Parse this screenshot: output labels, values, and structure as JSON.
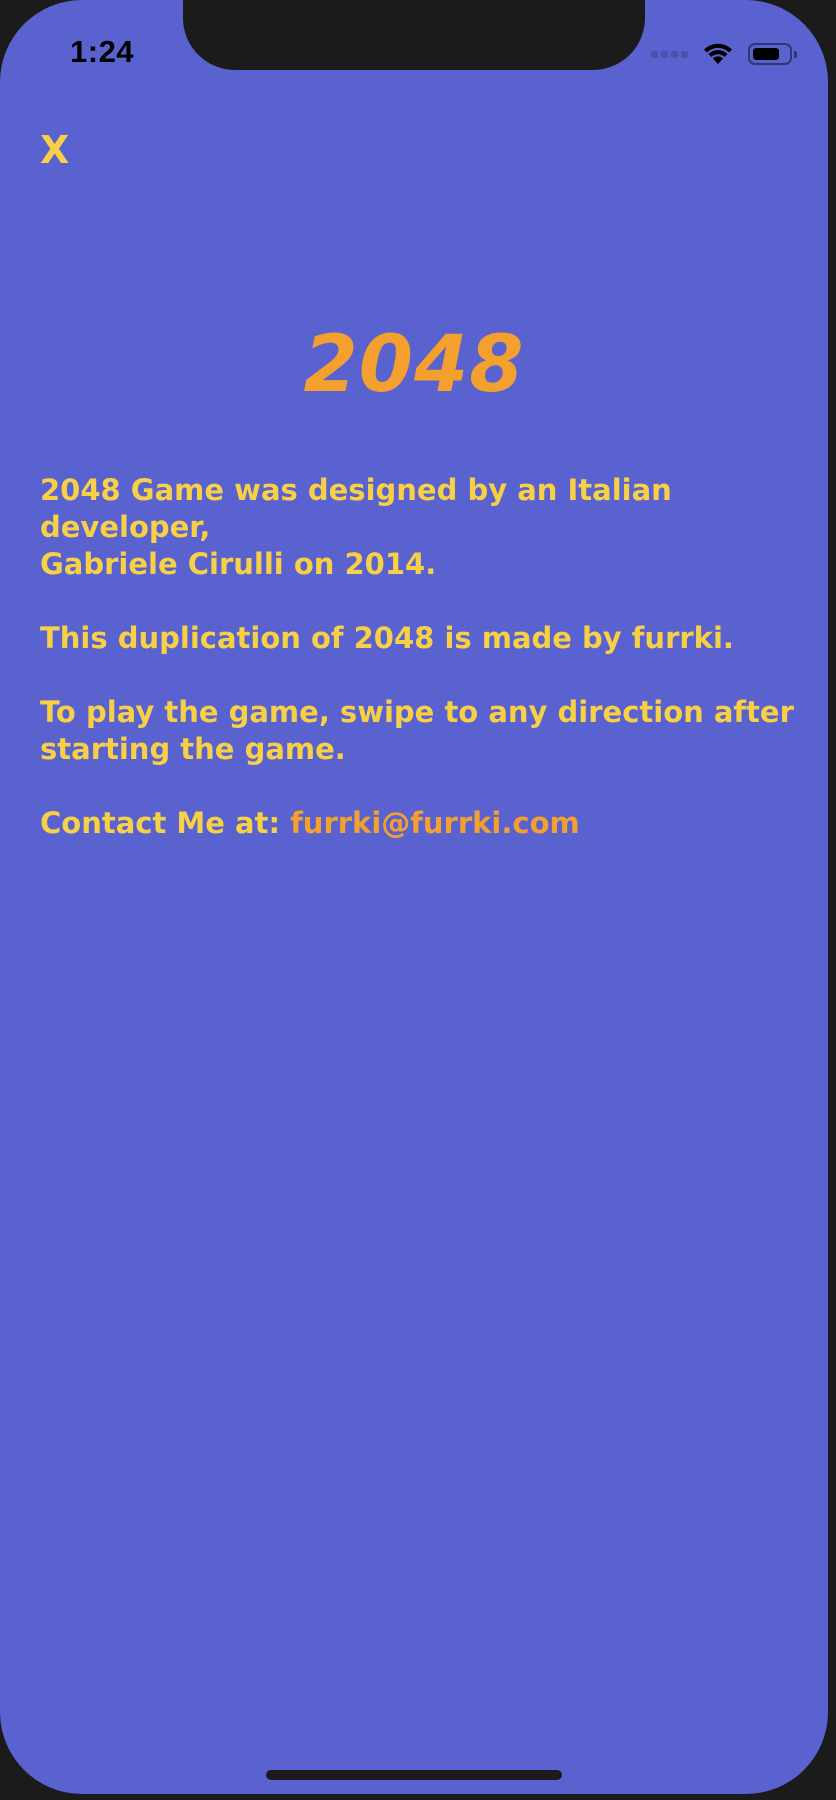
{
  "status_bar": {
    "time": "1:24",
    "icons": [
      "signal-icon",
      "wifi-icon",
      "battery-icon"
    ]
  },
  "header": {
    "close_label": "X"
  },
  "main": {
    "title": "2048",
    "paragraphs": [
      "2048 Game was designed by an Italian developer,\nGabriele Cirulli on 2014.",
      "This duplication of 2048 is made by furrki.",
      "To play the game, swipe to any direction after\nstarting the game."
    ],
    "contact_label": "Contact Me at: ",
    "contact_email": "furrki@furrki.com"
  },
  "colors": {
    "background": "#5962cf",
    "text_yellow": "#f7d046",
    "accent_orange": "#f3a02f",
    "device_frame": "#1b1b1b"
  }
}
